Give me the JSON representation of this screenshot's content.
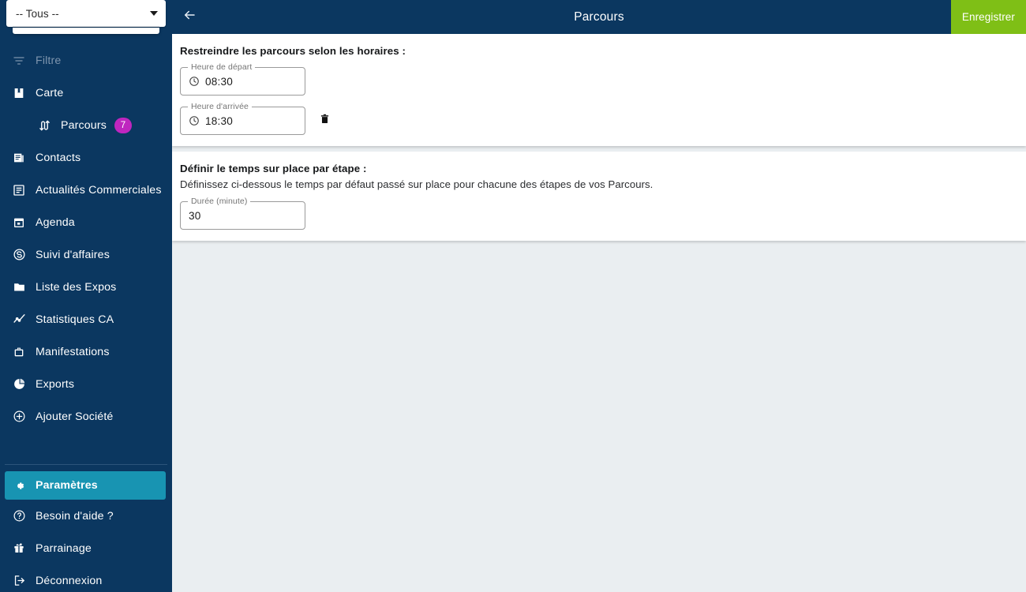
{
  "sidebar": {
    "company_select": {
      "value": "-- Tous --",
      "caret_icon": "chevron-down-icon"
    },
    "items": [
      {
        "label": "Filtre",
        "icon": "filter-icon",
        "state": "muted"
      },
      {
        "label": "Carte",
        "icon": "map-book-icon",
        "state": "normal"
      },
      {
        "label": "Parcours",
        "icon": "route-icon",
        "state": "sub",
        "badge": "7"
      },
      {
        "label": "Contacts",
        "icon": "contacts-icon",
        "state": "normal"
      },
      {
        "label": "Actualités Commerciales",
        "icon": "news-icon",
        "state": "normal"
      },
      {
        "label": "Agenda",
        "icon": "calendar-icon",
        "state": "normal"
      },
      {
        "label": "Suivi d'affaires",
        "icon": "deal-tracking-icon",
        "state": "normal"
      },
      {
        "label": "Liste des Expos",
        "icon": "folder-icon",
        "state": "normal"
      },
      {
        "label": "Statistiques CA",
        "icon": "chart-line-icon",
        "state": "normal"
      },
      {
        "label": "Manifestations",
        "icon": "briefcase-icon",
        "state": "normal"
      },
      {
        "label": "Exports",
        "icon": "pie-chart-icon",
        "state": "normal"
      },
      {
        "label": "Ajouter Société",
        "icon": "plus-circle-icon",
        "state": "normal"
      }
    ],
    "bottom_items": [
      {
        "label": "Paramètres",
        "icon": "gear-icon",
        "state": "active"
      },
      {
        "label": "Besoin d'aide ?",
        "icon": "help-circle-icon",
        "state": "normal"
      },
      {
        "label": "Parrainage",
        "icon": "gift-icon",
        "state": "normal"
      },
      {
        "label": "Déconnexion",
        "icon": "logout-icon",
        "state": "normal"
      }
    ],
    "colors": {
      "background": "#0b3760",
      "active": "#1894b2",
      "badge": "#bf26bf",
      "muted_text": "#7d94ad"
    }
  },
  "topbar": {
    "back_icon": "arrow-left-icon",
    "title": "Parcours",
    "save_label": "Enregistrer",
    "save_color": "#7fbf16",
    "background": "#0b3760"
  },
  "cards": {
    "schedule": {
      "title": "Restreindre les parcours selon les horaires :",
      "departure": {
        "label": "Heure de départ",
        "value": "08:30",
        "icon": "clock-icon"
      },
      "arrival": {
        "label": "Heure d'arrivée",
        "value": "18:30",
        "icon": "clock-icon"
      },
      "delete_icon": "trash-icon"
    },
    "duration": {
      "title": "Définir le temps sur place par étape :",
      "description": "Définissez ci-dessous le temps par défaut passé sur place pour chacune des étapes de vos Parcours.",
      "duration_field": {
        "label": "Durée (minute)",
        "value": "30"
      }
    }
  },
  "page": {
    "background": "#eaeef1"
  }
}
